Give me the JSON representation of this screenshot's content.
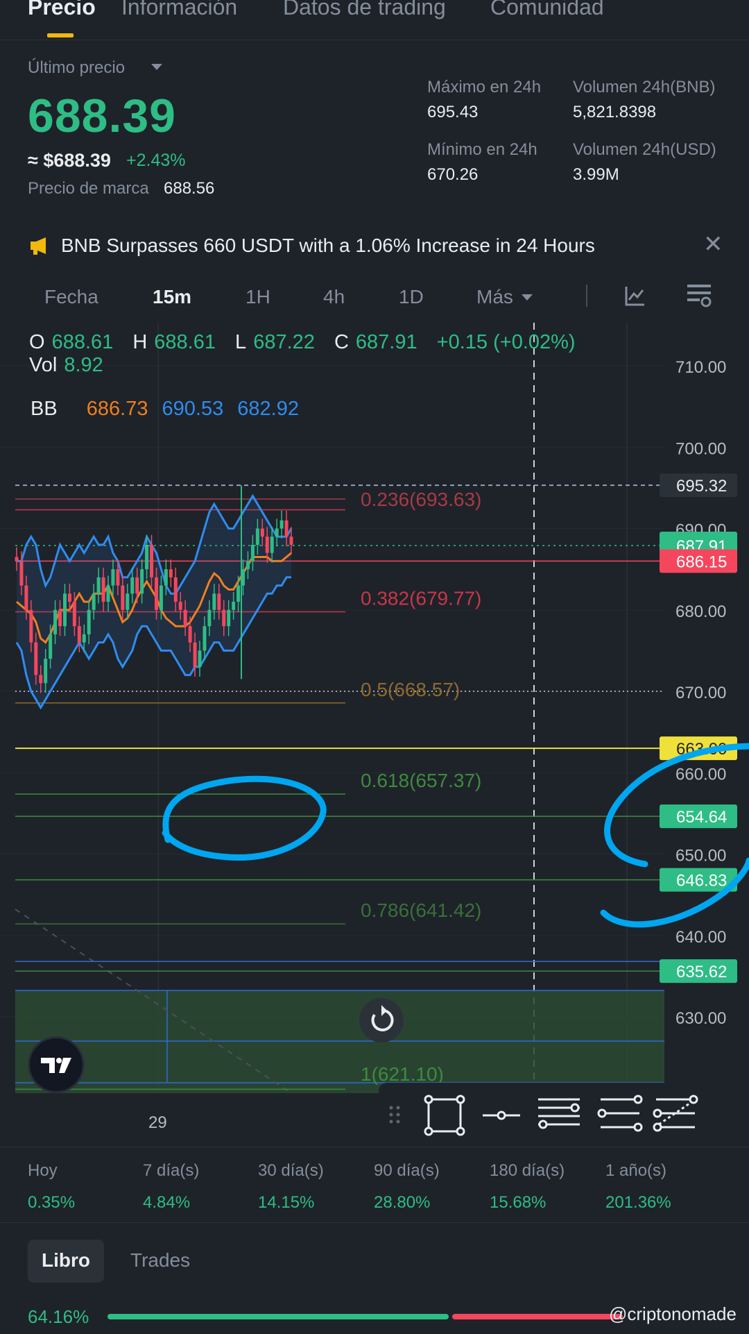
{
  "tabs": [
    {
      "label": "Precio",
      "active": true
    },
    {
      "label": "Información",
      "active": false
    },
    {
      "label": "Datos de trading",
      "active": false
    },
    {
      "label": "Comunidad",
      "active": false
    }
  ],
  "summary": {
    "last_price_label": "Último precio",
    "last_price": "688.39",
    "usd_price": "≈ $688.39",
    "change_pct": "+2.43%",
    "mark_price_label": "Precio de marca",
    "mark_price": "688.56",
    "high_label": "Máximo en 24h",
    "high_value": "695.43",
    "low_label": "Mínimo en 24h",
    "low_value": "670.26",
    "vol_bnb_label": "Volumen 24h(BNB)",
    "vol_bnb_value": "5,821.8398",
    "vol_usd_label": "Volumen 24h(USD)",
    "vol_usd_value": "3.99M"
  },
  "news": {
    "text": "BNB Surpasses 660 USDT with a 1.06% Increase in 24 Hours",
    "icon": "megaphone-icon"
  },
  "intervals": {
    "items": [
      "Fecha",
      "15m",
      "1H",
      "4h",
      "1D",
      "Más"
    ],
    "active": "15m"
  },
  "ohlc": {
    "o_label": "O",
    "o": "688.61",
    "h_label": "H",
    "h": "688.61",
    "l_label": "L",
    "l": "687.22",
    "c_label": "C",
    "c": "687.91",
    "change": "+0.15 (+0.02%)",
    "vol_label": "Vol",
    "vol": "8.92"
  },
  "bb": {
    "label": "BB",
    "mid": "686.73",
    "upper": "690.53",
    "lower": "682.92"
  },
  "colors": {
    "green": "#2ebd85",
    "red": "#f6465d",
    "orange": "#f07f1e",
    "blue": "#2f8cf0",
    "yellow": "#f0e03a",
    "annot": "#00a6f0",
    "bg": "#1e2329"
  },
  "chart_data": {
    "type": "line",
    "y_ticks": [
      "710.00",
      "700.00",
      "690.00",
      "680.00",
      "670.00",
      "660.00",
      "650.00",
      "640.00",
      "630.00"
    ],
    "x_ticks": [
      "29"
    ],
    "price_tags": [
      {
        "label": "695.32",
        "value": 695.32,
        "style": "gray"
      },
      {
        "label": "687.91",
        "value": 687.91,
        "style": "green"
      },
      {
        "label": "686.15",
        "value": 686.0,
        "style": "red"
      },
      {
        "label": "663.00",
        "value": 663.0,
        "style": "yellow"
      },
      {
        "label": "654.64",
        "value": 654.64,
        "style": "green"
      },
      {
        "label": "646.83",
        "value": 646.83,
        "style": "green"
      },
      {
        "label": "635.62",
        "value": 635.62,
        "style": "green"
      }
    ],
    "fib_levels": [
      {
        "label": "0.236(693.63)",
        "value": 693.63,
        "color": "#a83a47"
      },
      {
        "label": "0.382(679.77)",
        "value": 679.77,
        "color": "#c8364a"
      },
      {
        "label": "0.5(668.57)",
        "value": 668.57,
        "color": "#8e6a2d"
      },
      {
        "label": "0.618(657.37)",
        "value": 657.37,
        "color": "#3f8a3f"
      },
      {
        "label": "0.786(641.42)",
        "value": 641.42,
        "color": "#3a6f3a"
      },
      {
        "label": "1(621.10)",
        "value": 621.1,
        "color": "#3f8a3f"
      }
    ],
    "ylim": [
      620,
      713
    ],
    "candles_close": [
      686,
      683,
      680,
      676,
      672,
      671,
      674,
      677,
      680,
      678,
      682,
      681,
      678,
      676,
      677,
      680,
      682,
      684,
      681,
      683,
      685,
      683,
      680,
      682,
      684,
      682,
      685,
      688,
      684,
      680,
      683,
      685,
      684,
      681,
      680,
      678,
      676,
      673,
      675,
      678,
      680,
      682,
      680,
      678,
      680,
      681,
      683,
      685,
      686,
      688,
      690,
      689,
      687,
      689,
      690,
      691,
      689,
      688
    ],
    "bb_upper": [
      686,
      686,
      688,
      689,
      688,
      685,
      683,
      684,
      686,
      688,
      687,
      686,
      687,
      688,
      687,
      688,
      689,
      688,
      688,
      689,
      687,
      686,
      684,
      684,
      685,
      686,
      687,
      689,
      688,
      687,
      685,
      683,
      682,
      682,
      683,
      684,
      685,
      686,
      688,
      690,
      692,
      693,
      692,
      691,
      690,
      690,
      691,
      692,
      693,
      694,
      693,
      692,
      691,
      690,
      689,
      689,
      689,
      690
    ],
    "bb_lower": [
      676,
      675,
      672,
      670,
      669,
      668,
      669,
      670,
      671,
      672,
      673,
      674,
      675,
      676,
      675,
      674,
      675,
      676,
      676,
      677,
      676,
      674,
      673,
      674,
      675,
      677,
      678,
      678,
      677,
      676,
      675,
      675,
      675,
      674,
      673,
      672,
      672,
      673,
      673,
      674,
      675,
      676,
      676,
      675,
      675,
      675,
      676,
      677,
      678,
      679,
      680,
      681,
      682,
      682,
      683,
      683,
      684,
      684
    ]
  },
  "performance": [
    {
      "label": "Hoy",
      "value": "0.35%"
    },
    {
      "label": "7 día(s)",
      "value": "4.84%"
    },
    {
      "label": "30 día(s)",
      "value": "14.15%"
    },
    {
      "label": "90 día(s)",
      "value": "28.80%"
    },
    {
      "label": "180 día(s)",
      "value": "15.68%"
    },
    {
      "label": "1 año(s)",
      "value": "201.36%"
    }
  ],
  "book": {
    "tabs": [
      {
        "label": "Libro",
        "active": true
      },
      {
        "label": "Trades",
        "active": false
      }
    ],
    "buy_ratio": "64.16%",
    "buy_fraction": 0.6416
  },
  "watermark": "@criptonomade"
}
